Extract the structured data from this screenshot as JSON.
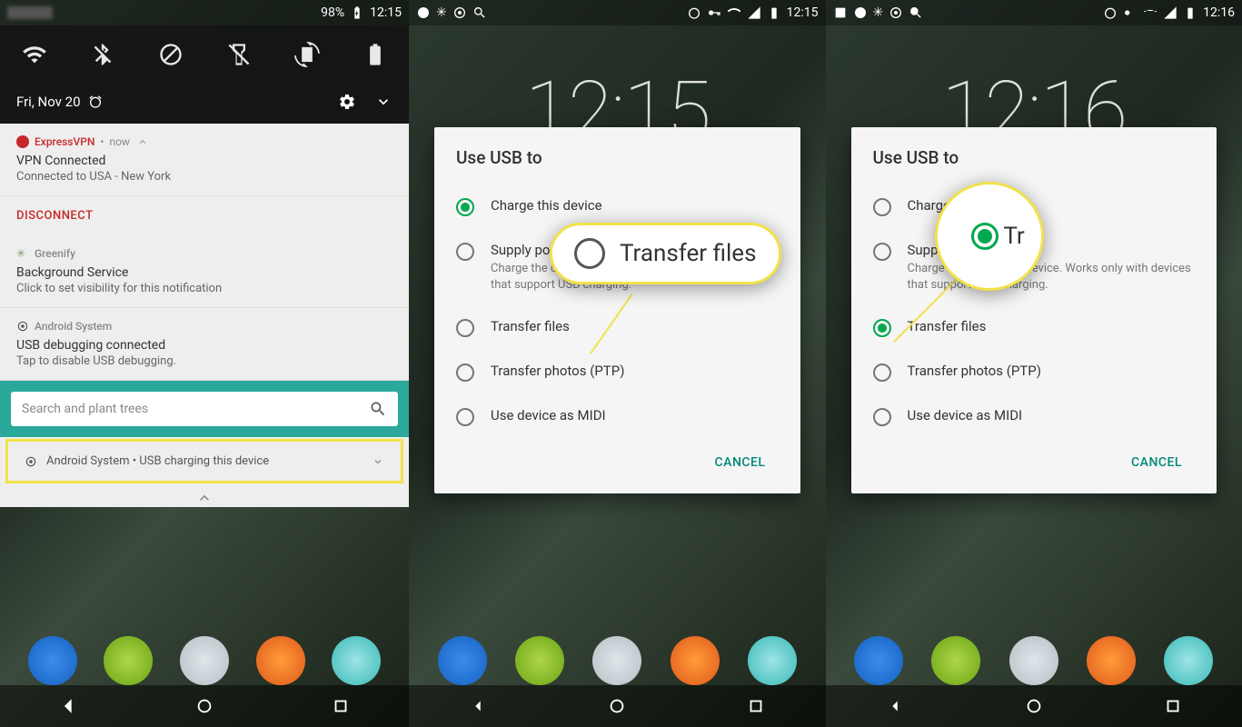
{
  "panel1": {
    "status": {
      "pct": "98%",
      "time": "12:15"
    },
    "date": "Fri, Nov 20",
    "notifs": [
      {
        "app": "ExpressVPN",
        "when": "now",
        "color": "#c62828",
        "title": "VPN Connected",
        "sub": "Connected to USA - New York",
        "action": "DISCONNECT"
      },
      {
        "app": "Greenify",
        "color": "#888",
        "title": "Background Service",
        "sub": "Click to set visibility for this notification"
      },
      {
        "app": "Android System",
        "color": "#555",
        "title": "USB debugging connected",
        "sub": "Tap to disable USB debugging."
      }
    ],
    "search": "Search and plant trees",
    "usb": "Android System • USB charging this device"
  },
  "dialog": {
    "title": "Use USB to",
    "opts": [
      {
        "label": "Charge this device"
      },
      {
        "label": "Supply power",
        "sub": "Charge the connected device. Works only with devices that support USB charging."
      },
      {
        "label": "Transfer files"
      },
      {
        "label": "Transfer photos (PTP)"
      },
      {
        "label": "Use device as MIDI"
      }
    ],
    "cancel": "CANCEL"
  },
  "panel2": {
    "time": "12:15",
    "clock": "12:15",
    "selected": 0,
    "callout": "Transfer files"
  },
  "panel3": {
    "time": "12:16",
    "clock": "12:16",
    "selected": 2,
    "callout": "Tr"
  }
}
